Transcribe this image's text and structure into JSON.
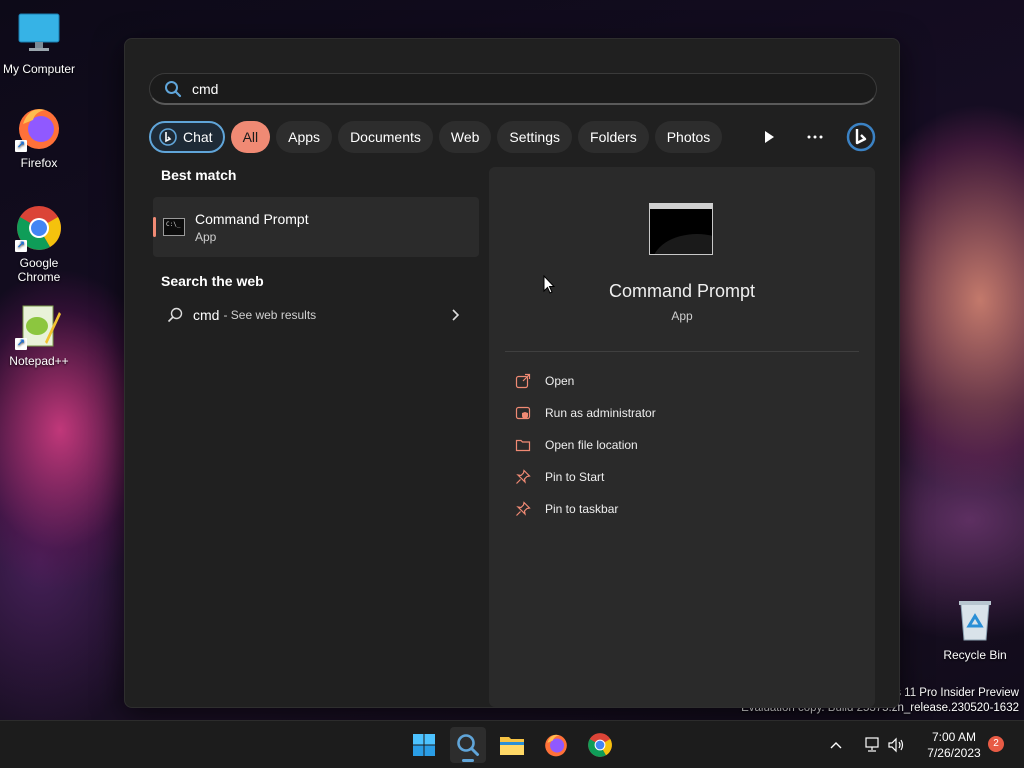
{
  "desktop": {
    "icons": [
      {
        "label": "My Computer",
        "icon": "monitor-icon"
      },
      {
        "label": "Firefox",
        "icon": "firefox-icon"
      },
      {
        "label": "Google Chrome",
        "icon": "chrome-icon"
      },
      {
        "label": "Notepad++",
        "icon": "notepadpp-icon"
      },
      {
        "label": "Recycle Bin",
        "icon": "recycle-bin-icon"
      }
    ]
  },
  "search": {
    "query": "cmd",
    "filters": [
      "Chat",
      "All",
      "Apps",
      "Documents",
      "Web",
      "Settings",
      "Folders",
      "Photos"
    ],
    "active_filter": "All"
  },
  "results": {
    "best_match_title": "Best match",
    "best_match": {
      "name": "Command Prompt",
      "type": "App"
    },
    "web_title": "Search the web",
    "web_item": {
      "query": "cmd",
      "hint": "- See web results"
    }
  },
  "preview": {
    "name": "Command Prompt",
    "type": "App",
    "actions": [
      {
        "label": "Open",
        "icon": "open-external-icon"
      },
      {
        "label": "Run as administrator",
        "icon": "shield-admin-icon"
      },
      {
        "label": "Open file location",
        "icon": "folder-icon"
      },
      {
        "label": "Pin to Start",
        "icon": "pin-icon"
      },
      {
        "label": "Pin to taskbar",
        "icon": "pin-icon"
      }
    ]
  },
  "watermark": {
    "line1": "s 11 Pro Insider Preview",
    "line2": "Evaluation copy. Build 25375.zn_release.230520-1632"
  },
  "taskbar": {
    "time": "7:00 AM",
    "date": "7/26/2023",
    "notifications": "2"
  },
  "colors": {
    "accent": "#60a5d9",
    "filter_active": "#f08a74"
  }
}
